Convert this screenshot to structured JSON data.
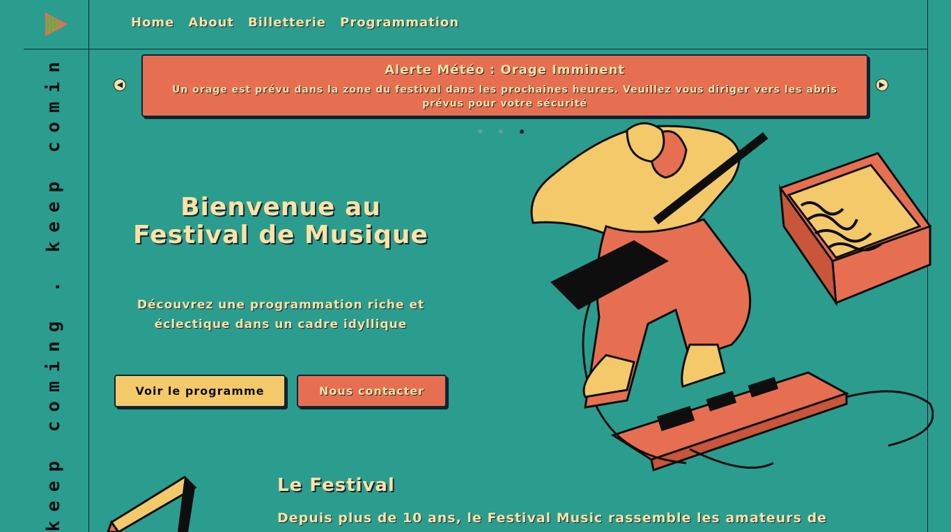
{
  "brand": {
    "logo_icon": "play-bars-logo-icon"
  },
  "rail": {
    "marquee": "keep coming . keep coming . keep com"
  },
  "nav": {
    "items": [
      "Home",
      "About",
      "Billetterie",
      "Programmation"
    ]
  },
  "alert": {
    "title": "Alerte Météo : Orage Imminent",
    "message": "Un orage est prévu dans la zone du festival dans les prochaines heures. Veuillez vous diriger vers les abris prévus pour votre sécurité",
    "prev_icon": "chevron-left-icon",
    "next_icon": "chevron-right-icon",
    "slides_total": 3,
    "active_slide": 3
  },
  "hero": {
    "title": "Bienvenue au Festival de Musique",
    "subtitle": "Découvrez une programmation riche et éclectique dans un cadre idyllique",
    "primary_button": "Voir le programme",
    "secondary_button": "Nous contacter"
  },
  "festival": {
    "title": "Le Festival",
    "text": "Depuis plus de 10 ans, le Festival Music rassemble les amateurs de"
  },
  "colors": {
    "background": "#2a9d8f",
    "accent_yellow": "#f4c96a",
    "accent_orange": "#e76f51",
    "text_light": "#fde2a3",
    "ink": "#112233"
  }
}
